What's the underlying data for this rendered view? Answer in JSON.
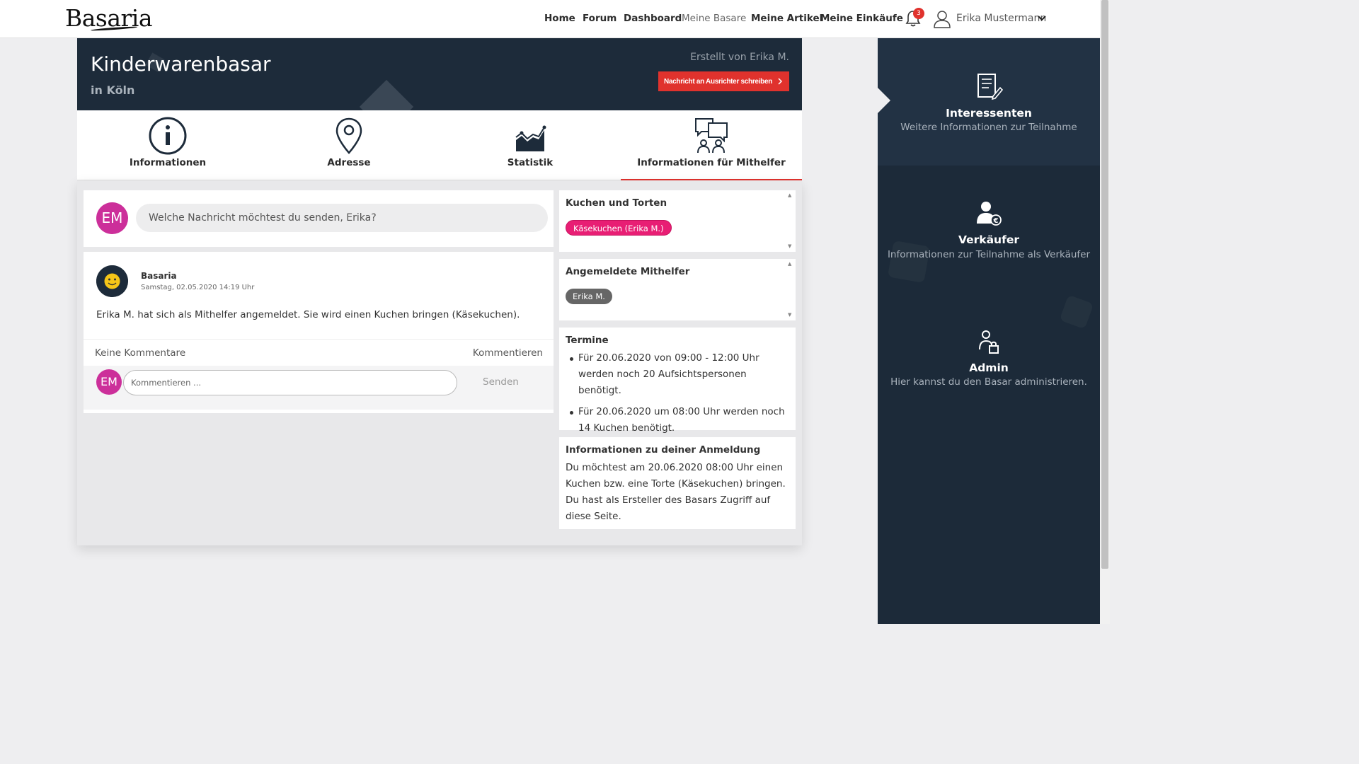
{
  "brand": {
    "logo": "Basaria"
  },
  "nav": {
    "items": [
      "Home",
      "Forum",
      "Dashboard",
      "Meine Basare",
      "Meine Artikel",
      "Meine Einkäufe"
    ],
    "notification_count": "3",
    "user_name": "Erika Mustermann"
  },
  "banner": {
    "title": "Kinderwarenbasar",
    "subtitle": "in Köln",
    "created_by": "Erstellt von Erika M.",
    "message_button": "Nachricht an Ausrichter schreiben"
  },
  "tabs": [
    {
      "label": "Informationen",
      "icon": "info-icon"
    },
    {
      "label": "Adresse",
      "icon": "map-pin-icon"
    },
    {
      "label": "Statistik",
      "icon": "chart-icon"
    },
    {
      "label": "Informationen für Mithelfer",
      "icon": "helpers-chat-icon"
    }
  ],
  "compose": {
    "avatar_initials": "EM",
    "placeholder": "Welche Nachricht möchtest du senden, Erika?"
  },
  "post": {
    "author": "Basaria",
    "date": "Samstag, 02.05.2020 14:19 Uhr",
    "text": "Erika M. hat sich als Mithelfer angemeldet. Sie wird einen Kuchen bringen (Käsekuchen).",
    "no_comments": "Keine Kommentare",
    "comment_link": "Kommentieren",
    "comment_avatar": "EM",
    "comment_placeholder": "Kommentieren ...",
    "send_label": "Senden"
  },
  "side": {
    "cakes": {
      "title": "Kuchen und Torten",
      "pill": "Käsekuchen (Erika M.)"
    },
    "helpers": {
      "title": "Angemeldete Mithelfer",
      "pill": "Erika M."
    },
    "dates": {
      "title": "Termine",
      "items": [
        "Für 20.06.2020 von 09:00 - 12:00 Uhr werden noch 20 Aufsichtspersonen benötigt.",
        "Für 20.06.2020 um 08:00 Uhr werden noch 14 Kuchen benötigt."
      ]
    },
    "registration": {
      "title": "Informationen zu deiner Anmeldung",
      "line1": "Du möchtest am 20.06.2020 08:00 Uhr einen Kuchen bzw. eine Torte (Käsekuchen) bringen.",
      "line2": "Du hast als Ersteller des Basars Zugriff auf diese Seite."
    }
  },
  "rightbar": {
    "sections": [
      {
        "title": "Interessenten",
        "subtitle": "Weitere Informationen zur Teilnahme",
        "icon": "document-edit-icon"
      },
      {
        "title": "Verkäufer",
        "subtitle": "Informationen zur Teilnahme als Verkäufer",
        "icon": "seller-euro-icon"
      },
      {
        "title": "Admin",
        "subtitle": "Hier kannst du den Basar administrieren.",
        "icon": "admin-lock-icon"
      }
    ]
  },
  "colors": {
    "accent": "#e0322d",
    "dark": "#1d2b3a",
    "avatar": "#cc2f9a",
    "pill_pink": "#e81e74"
  }
}
